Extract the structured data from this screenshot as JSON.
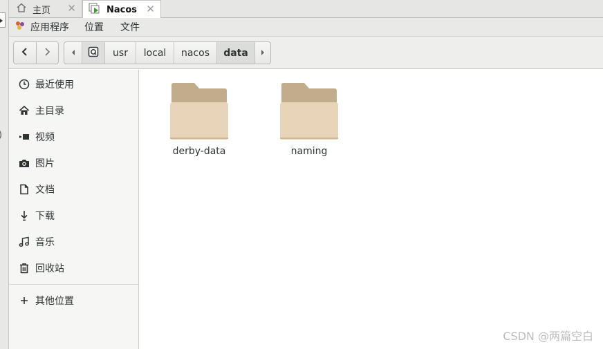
{
  "vm_tabs": [
    {
      "label": "主页",
      "icon": "home-icon"
    },
    {
      "label": "Nacos",
      "icon": "vm-running-icon",
      "active": true
    }
  ],
  "menubar": {
    "applications": "应用程序",
    "places": "位置",
    "files": "文件"
  },
  "path": [
    "usr",
    "local",
    "nacos",
    "data"
  ],
  "current_folder": "data",
  "sidebar": {
    "items": [
      {
        "label": "最近使用",
        "icon": "clock-icon"
      },
      {
        "label": "主目录",
        "icon": "home-icon"
      },
      {
        "label": "视频",
        "icon": "video-icon"
      },
      {
        "label": "图片",
        "icon": "camera-icon"
      },
      {
        "label": "文档",
        "icon": "document-icon"
      },
      {
        "label": "下载",
        "icon": "download-icon"
      },
      {
        "label": "音乐",
        "icon": "music-icon"
      },
      {
        "label": "回收站",
        "icon": "trash-icon"
      }
    ],
    "other_locations": {
      "label": "其他位置",
      "icon": "plus-icon"
    }
  },
  "files": [
    {
      "name": "derby-data",
      "type": "folder"
    },
    {
      "name": "naming",
      "type": "folder"
    }
  ],
  "watermark": "CSDN @两篇空白",
  "colors": {
    "folder_back": "#c1ac8c",
    "folder_front": "#e7d4b9",
    "selected_path": "#dcdcda"
  }
}
